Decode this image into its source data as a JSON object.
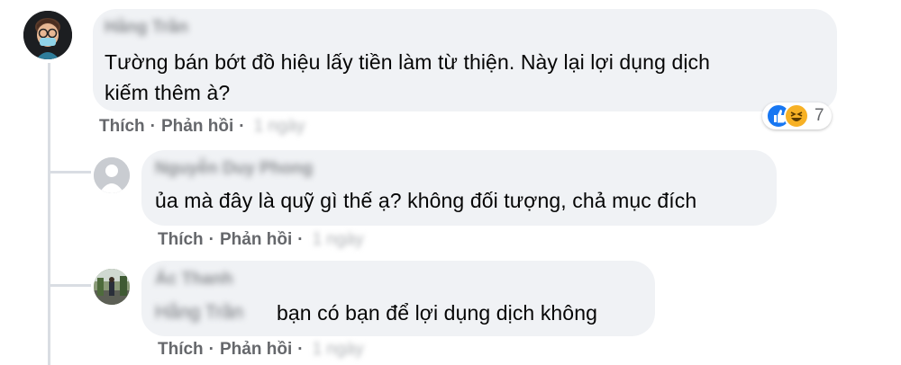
{
  "comments": [
    {
      "author": "Hằng Trần",
      "text_line1": "Tường bán bớt đồ hiệu lấy tiền làm từ thiện. Này lại lợi dụng dịch",
      "text_line2": "kiếm thêm à?",
      "like_label": "Thích",
      "reply_label": "Phản hồi",
      "time": "1 ngày",
      "reaction_count": "7",
      "reaction_icons": [
        "like-icon",
        "haha-icon"
      ]
    },
    {
      "author": "Nguyễn Duy Phong",
      "text": "ủa mà đây là quỹ gì thế ạ? không đối tượng, chả mục đích",
      "like_label": "Thích",
      "reply_label": "Phản hồi",
      "time": "1 ngày"
    },
    {
      "author": "Ác Thanh",
      "mention": "Hằng Trần",
      "text": "bạn có bạn để lợi dụng dịch không",
      "like_label": "Thích",
      "reply_label": "Phản hồi",
      "time": "1 ngày"
    }
  ],
  "colors": {
    "bubble": "#f0f2f5",
    "action_text": "#65676b",
    "thread_line": "#d9dde3",
    "like_blue": "#1877f2",
    "haha_yellow": "#f7b125"
  }
}
